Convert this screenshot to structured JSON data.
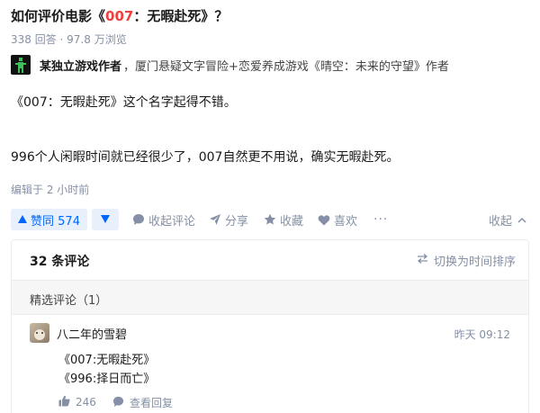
{
  "question": {
    "title_prefix": "如何评价电影《",
    "title_highlight": "007",
    "title_suffix": "：无暇赴死》？",
    "meta": "338 回答 · 97.8 万浏览"
  },
  "answer": {
    "author_name": "某独立游戏作者",
    "author_bio": "，厦门悬疑文字冒险+恋爱养成游戏《晴空：未来的守望》作者",
    "paragraphs": [
      "《007：无暇赴死》这个名字起得不错。",
      "996个人闲暇时间就已经很少了，007自然更不用说，确实无暇赴死。"
    ],
    "edited": "编辑于 2 小时前"
  },
  "actions": {
    "vote_up_label": "赞同 574",
    "collapse_comments": "收起评论",
    "share": "分享",
    "favorite": "收藏",
    "like": "喜欢",
    "more": "···",
    "collapse": "收起"
  },
  "comments": {
    "count_label": "32 条评论",
    "sort_toggle": "切换为时间排序",
    "featured_label": "精选评论（1）",
    "items": [
      {
        "user": "八二年的雪碧",
        "time": "昨天 09:12",
        "lines": [
          "《007:无暇赴死》",
          "《996:择日而亡》"
        ],
        "likes": "246",
        "view_replies": "查看回复"
      }
    ]
  },
  "colors": {
    "accent_blue": "#0066ff",
    "highlight_red": "#f1403c",
    "muted": "#8590a6"
  }
}
